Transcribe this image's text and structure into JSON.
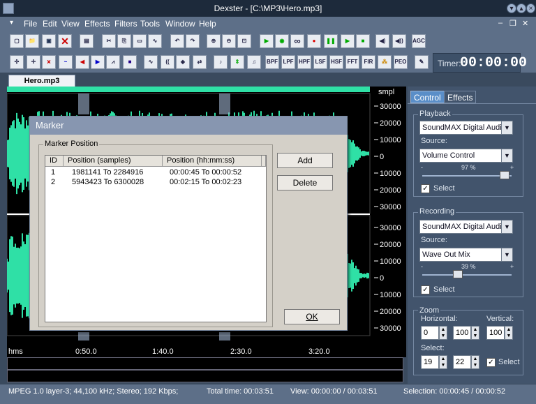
{
  "window": {
    "title": "Dexster - [C:\\MP3\\Hero.mp3]"
  },
  "menu": {
    "items": [
      "File",
      "Edit",
      "View",
      "Effects",
      "Filters",
      "Tools",
      "Window",
      "Help"
    ]
  },
  "toolbar1": {
    "agc_label": "AGC"
  },
  "toolbar2": {
    "filter_labels": [
      "BPF",
      "LPF",
      "HPF",
      "LSF",
      "HSF",
      "FFT",
      "FIR",
      "",
      "PEO"
    ]
  },
  "timer": {
    "label": "Timer:",
    "value": "00:00:00"
  },
  "document_tab": "Hero.mp3",
  "waveform": {
    "unit_label": "smpl",
    "ruler_top": [
      "30000",
      "20000",
      "10000",
      "0",
      "10000",
      "20000",
      "30000"
    ],
    "ruler_bottom": [
      "30000",
      "20000",
      "10000",
      "0",
      "10000",
      "20000",
      "30000"
    ],
    "wave_color": "#2fe0a6",
    "time_axis": {
      "unit": "hms",
      "ticks": [
        "0:50.0",
        "1:40.0",
        "2:30.0",
        "3:20.0"
      ]
    }
  },
  "panel": {
    "tabs": [
      "Control",
      "Effects"
    ],
    "playback": {
      "label": "Playback",
      "device": "SoundMAX Digital Audio",
      "source_label": "Source:",
      "source": "Volume Control",
      "volume_text": "97 %",
      "volume": 97,
      "select_label": "Select",
      "select_checked": true
    },
    "recording": {
      "label": "Recording",
      "device": "SoundMAX Digital Audio",
      "source_label": "Source:",
      "source": "Wave Out Mix",
      "volume_text": "39 %",
      "volume": 39,
      "select_label": "Select",
      "select_checked": true
    },
    "zoom": {
      "label": "Zoom",
      "horizontal_label": "Horizontal:",
      "vertical_label": "Vertical:",
      "h_value1": "0",
      "h_value2": "100",
      "v_value": "100",
      "select_label": "Select:",
      "sel_value1": "19",
      "sel_value2": "22",
      "select_checkbox_label": "Select",
      "select_checked": true
    }
  },
  "dialog": {
    "title": "Marker",
    "group_label": "Marker Position",
    "columns": [
      "ID",
      "Position (samples)",
      "Position (hh:mm:ss)"
    ],
    "rows": [
      {
        "id": "1",
        "samples": "1981141 To  2284916",
        "time": "00:00:45 To 00:00:52"
      },
      {
        "id": "2",
        "samples": "5943423 To  6300028",
        "time": "00:02:15 To 00:02:23"
      }
    ],
    "add_label": "Add",
    "delete_label": "Delete",
    "ok_label": "OK"
  },
  "status": {
    "format": "MPEG 1.0 layer-3; 44,100 kHz; Stereo; 192 Kbps;",
    "total_time": "Total time: 00:03:51",
    "view": "View: 00:00:00 / 00:03:51",
    "selection": "Selection: 00:00:45 / 00:00:52"
  }
}
